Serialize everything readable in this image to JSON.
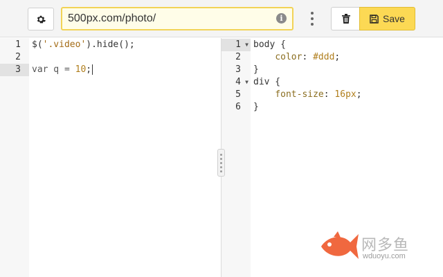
{
  "toolbar": {
    "settings_icon": "gear-icon",
    "url_value": "500px.com/photo/",
    "url_placeholder": "",
    "info_glyph": "i",
    "more_icon": "kebab-menu-icon",
    "delete_icon": "trash-icon",
    "save_icon": "floppy-disk-icon",
    "save_label": "Save",
    "accent_color": "#fcd954"
  },
  "js_editor": {
    "active_line": 3,
    "line_numbers": [
      "1",
      "2",
      "3"
    ],
    "lines": {
      "l1_fn": "$(",
      "l1_str": "'.video'",
      "l1_rest": ").hide();",
      "l3_kw": "var q = ",
      "l3_num": "10",
      "l3_end": ";"
    }
  },
  "css_editor": {
    "active_line": 1,
    "line_numbers": [
      "1",
      "2",
      "3",
      "4",
      "5",
      "6"
    ],
    "lines": {
      "l1": "body {",
      "l2_prop": "color",
      "l2_colon": ": ",
      "l2_val": "#ddd",
      "l2_end": ";",
      "l3": "}",
      "l4": "div {",
      "l5_prop": "font-size",
      "l5_colon": ": ",
      "l5_val": "16px",
      "l5_end": ";",
      "l6": "}"
    }
  },
  "watermark": {
    "text": "网多鱼",
    "url": "wduoyu.com",
    "logo_icon": "fish-logo-icon",
    "logo_color": "#f0683f"
  }
}
